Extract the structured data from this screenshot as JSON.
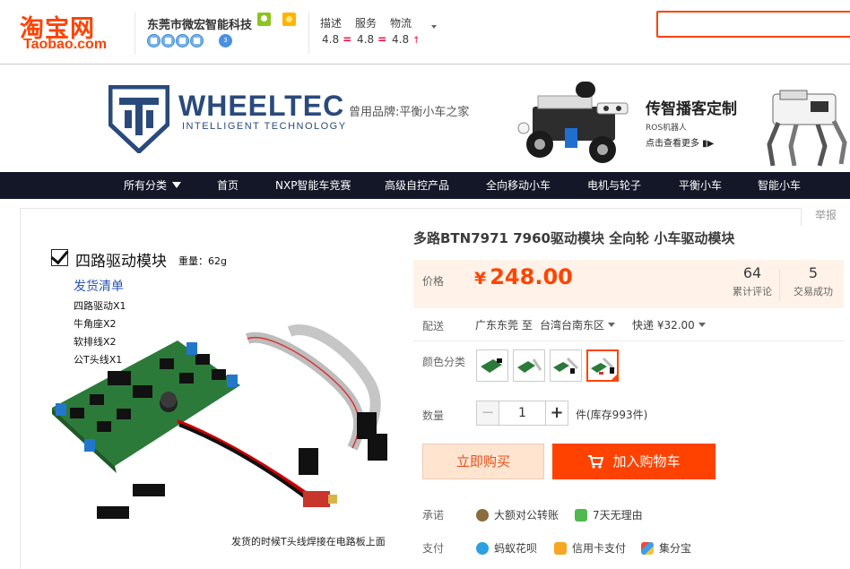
{
  "header": {
    "logo_cn": "淘宝网",
    "logo_en": "Taobao.com",
    "shop_name": "东莞市微宏智能科技",
    "shop_level_badge": "3",
    "ratings": [
      {
        "label": "描述",
        "value": "4.8",
        "trend": "="
      },
      {
        "label": "服务",
        "value": "4.8",
        "trend": "="
      },
      {
        "label": "物流",
        "value": "4.8",
        "trend": "↑"
      }
    ]
  },
  "banner": {
    "brand": "WHEELTEC",
    "brand_sub": "INTELLIGENT TECHNOLOGY",
    "slogan": "曾用品牌:平衡小车之家",
    "promo_title": "传智播客定制",
    "promo_sub": "ROS机器人",
    "promo_link": "点击查看更多 ▮▶"
  },
  "nav": {
    "items": [
      "所有分类",
      "首页",
      "NXP智能车竞赛",
      "高级自控产品",
      "全向移动小车",
      "电机与轮子",
      "平衡小车",
      "智能小车"
    ]
  },
  "image_panel": {
    "title": "四路驱动模块",
    "weight": "重量：62g",
    "list_title": "发货清单",
    "list_items": [
      "四路驱动X1",
      "牛角座X2",
      "软排线X2",
      "公T头线X1"
    ],
    "caption": "发货的时候T头线焊接在电路板上面"
  },
  "product": {
    "report_label": "举报",
    "title": "多路BTN7971 7960驱动模块 全向轮 小车驱动模块",
    "price_label": "价格",
    "price_symbol": "¥",
    "price": "248.00",
    "reviews_count": "64",
    "reviews_label": "累计评论",
    "deals_count": "5",
    "deals_label": "交易成功",
    "ship_label": "配送",
    "ship_from": "广东东莞 至",
    "ship_to": "台湾台南东区",
    "ship_fee": "快递 ¥32.00",
    "color_label": "颜色分类",
    "qty_label": "数量",
    "qty_minus": "−",
    "qty_value": "1",
    "qty_plus": "+",
    "stock": "件(库存993件)",
    "buy_label": "立即购买",
    "cart_label": "加入购物车",
    "promise_label": "承诺",
    "promise_items": [
      "大额对公转账",
      "7天无理由"
    ],
    "pay_label": "支付",
    "pay_items": [
      "蚂蚁花呗",
      "信用卡支付",
      "集分宝"
    ]
  },
  "colors": {
    "brand_orange": "#ff4200",
    "price_red": "#ff4400",
    "nav_bg": "#131728",
    "wheeltec_blue": "#2a4a7c"
  }
}
